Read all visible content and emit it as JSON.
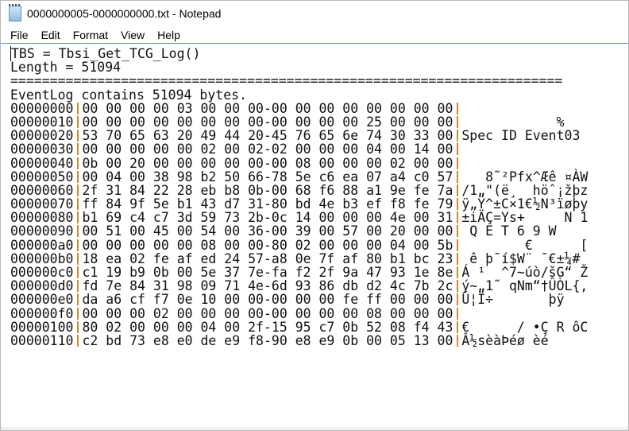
{
  "window": {
    "title": "0000000005-0000000000.txt - Notepad"
  },
  "menu": [
    "File",
    "Edit",
    "Format",
    "View",
    "Help"
  ],
  "header_lines": [
    "TBS = Tbsi_Get_TCG_Log()",
    "Length = 51094",
    "======================================================================",
    "EventLog contains 51094 bytes."
  ],
  "rows": [
    {
      "addr": "00000000",
      "hex": "00 00 00 00 03 00 00 00-00 00 00 00 00 00 00 00",
      "ascii": ""
    },
    {
      "addr": "00000010",
      "hex": "00 00 00 00 00 00 00 00-00 00 00 00 25 00 00 00",
      "ascii": "            %"
    },
    {
      "addr": "00000020",
      "hex": "53 70 65 63 20 49 44 20-45 76 65 6e 74 30 33 00",
      "ascii": "Spec ID Event03"
    },
    {
      "addr": "00000030",
      "hex": "00 00 00 00 00 02 00 02-02 00 00 00 04 00 14 00",
      "ascii": ""
    },
    {
      "addr": "00000040",
      "hex": "0b 00 20 00 00 00 00 00-00 08 00 00 00 02 00 00",
      "ascii": ""
    },
    {
      "addr": "00000050",
      "hex": "00 04 00 38 98 b2 50 66-78 5e c6 ea 07 a4 c0 57",
      "ascii": "   8˜²Pfx^Æê ¤ÀW"
    },
    {
      "addr": "00000060",
      "hex": "2f 31 84 22 28 eb b8 0b-00 68 f6 88 a1 9e fe 7a",
      "ascii": "/1„\"(ë¸  höˆ¡žþz"
    },
    {
      "addr": "00000070",
      "hex": "ff 84 9f 5e b1 43 d7 31-80 bd 4e b3 ef f8 fe 79",
      "ascii": "ÿ„Ÿ^±C×1€½N³ïøþy"
    },
    {
      "addr": "00000080",
      "hex": "b1 69 c4 c7 3d 59 73 2b-0c 14 00 00 00 4e 00 31",
      "ascii": "±iÄÇ=Ys+     N 1"
    },
    {
      "addr": "00000090",
      "hex": "00 51 00 45 00 54 00 36-00 39 00 57 00 20 00 00",
      "ascii": " Q E T 6 9 W"
    },
    {
      "addr": "000000a0",
      "hex": "00 00 00 00 00 08 00 00-80 02 00 00 00 04 00 5b",
      "ascii": "        €      ["
    },
    {
      "addr": "000000b0",
      "hex": "18 ea 02 fe af ed 24 57-a8 0e 7f af 80 b1 bc 23",
      "ascii": " ê þ¯í$W¨ ¯€±¼#"
    },
    {
      "addr": "000000c0",
      "hex": "c1 19 b9 0b 00 5e 37 7e-fa f2 2f 9a 47 93 1e 8e",
      "ascii": "Á ¹  ^7~úò/šG“ Ž"
    },
    {
      "addr": "000000d0",
      "hex": "fd 7e 84 31 98 09 71 4e-6d 93 86 db d2 4c 7b 2c",
      "ascii": "ý~„1˜ qNm“†ÛÒL{,"
    },
    {
      "addr": "000000e0",
      "hex": "da a6 cf f7 0e 10 00 00-00 00 00 fe ff 00 00 00",
      "ascii": "Ú¦Ï÷       þÿ"
    },
    {
      "addr": "000000f0",
      "hex": "00 00 00 02 00 00 00 00-00 00 00 00 08 00 00 00",
      "ascii": ""
    },
    {
      "addr": "00000100",
      "hex": "80 02 00 00 00 04 00 2f-15 95 c7 0b 52 08 f4 43",
      "ascii": "€      / •Ç R ôC"
    },
    {
      "addr": "00000110",
      "hex": "c2 bd 73 e8 e0 de e9 f8-90 e8 e9 0b 00 05 13 00",
      "ascii": "Â½sèàÞéø èé"
    }
  ]
}
